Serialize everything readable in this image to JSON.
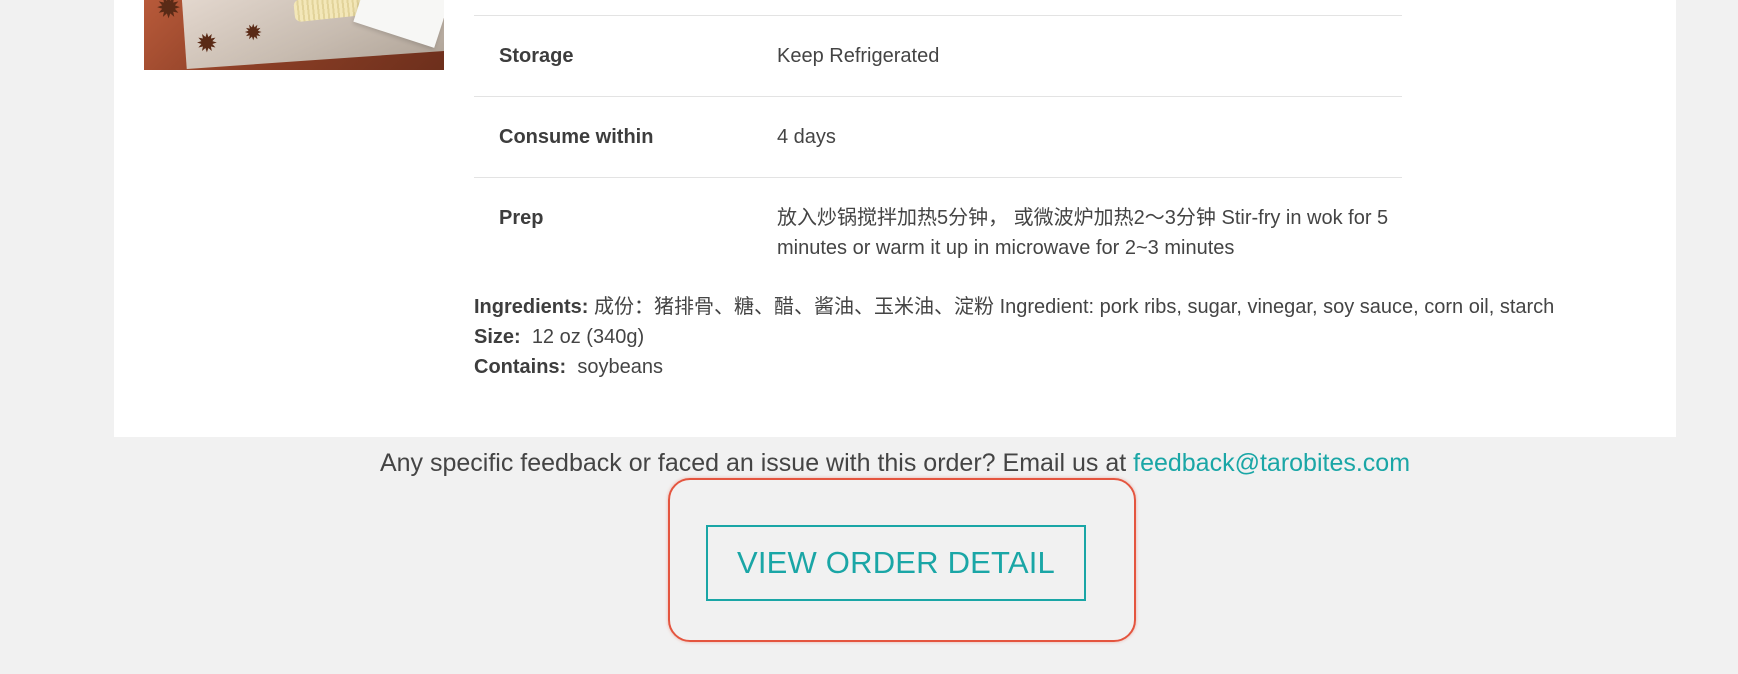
{
  "product": {
    "image_alt": "product photo (braised dish with star anise and noodles)"
  },
  "details": [
    {
      "label": "Storage",
      "value": "Keep Refrigerated"
    },
    {
      "label": "Consume within",
      "value": "4 days"
    },
    {
      "label": "Prep",
      "value": "放入炒锅搅拌加热5分钟， 或微波炉加热2～3分钟 Stir-fry in wok for 5 minutes or warm it up in microwave for 2~3 minutes"
    }
  ],
  "extra": {
    "ingredients_label": "Ingredients:",
    "ingredients_value": "成份：猪排骨、糖、醋、酱油、玉米油、淀粉 Ingredient: pork ribs, sugar, vinegar, soy sauce, corn oil, starch",
    "size_label": "Size:",
    "size_value": "12 oz (340g)",
    "contains_label": "Contains:",
    "contains_value": "soybeans"
  },
  "feedback": {
    "text": "Any specific feedback or faced an issue with this order? Email us at ",
    "email": "feedback@tarobites.com"
  },
  "cta": {
    "label": "VIEW ORDER DETAIL"
  },
  "colors": {
    "accent": "#1aa6a6",
    "highlight": "#e4553f",
    "page_bg": "#f1f1f1",
    "card_bg": "#ffffff"
  }
}
